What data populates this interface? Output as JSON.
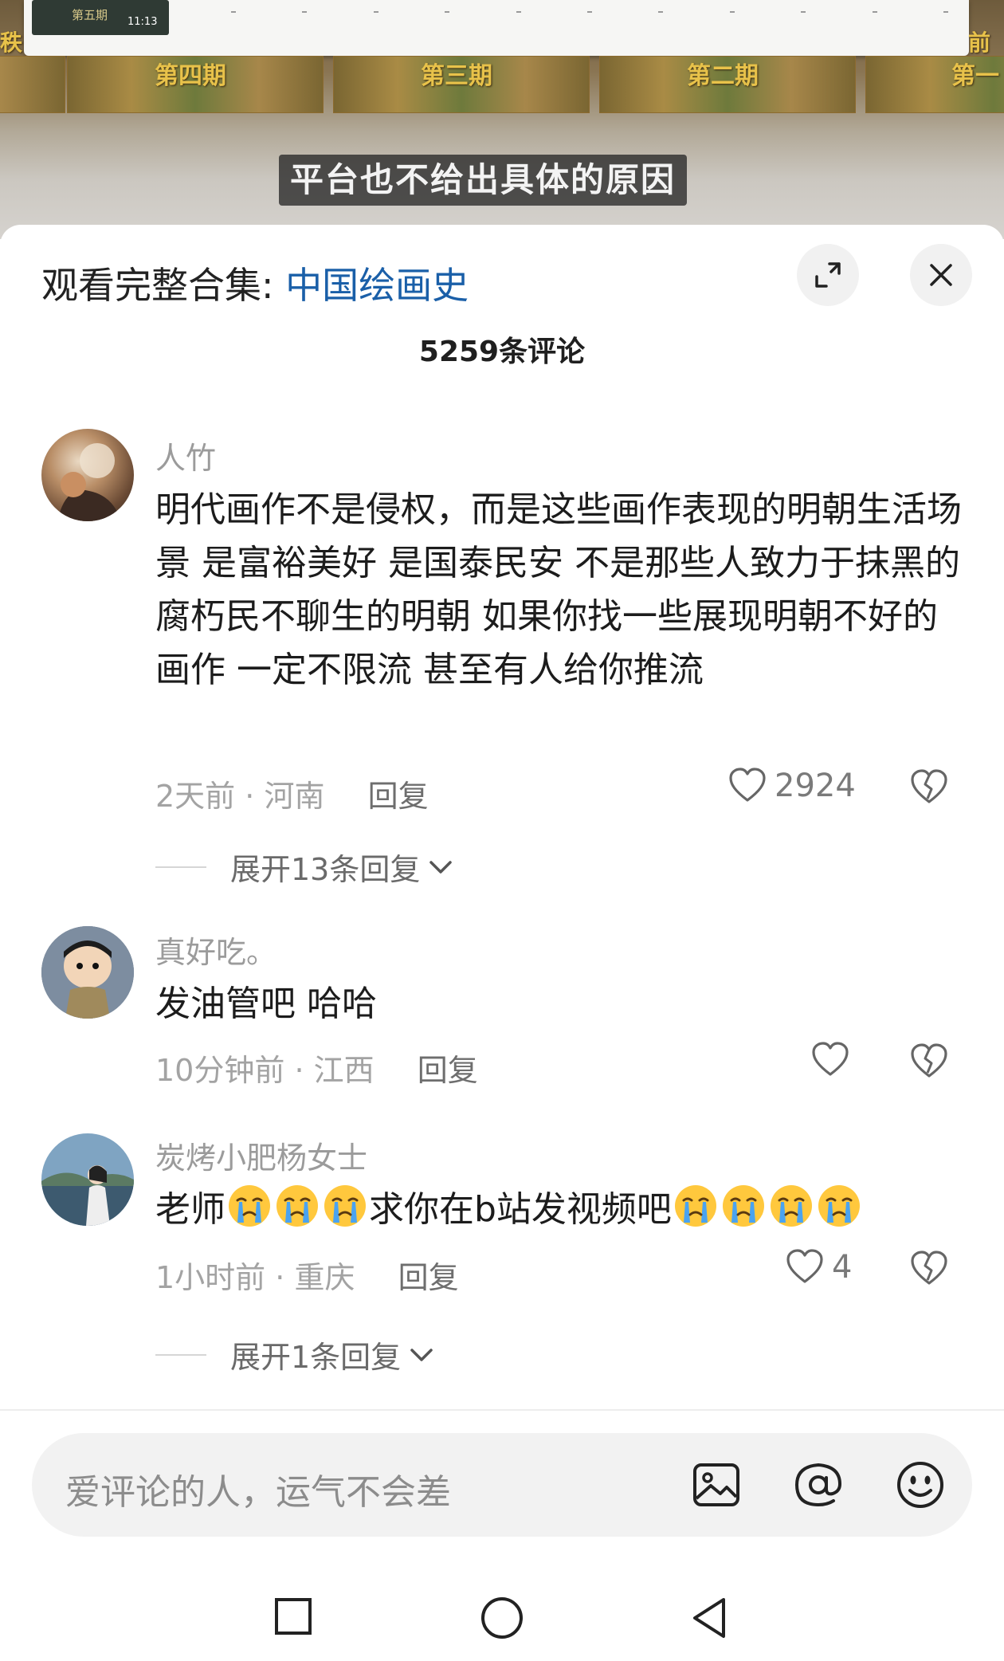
{
  "video": {
    "thumb_caption": "第五期",
    "thumb_time": "11:13",
    "episodes": [
      "第四期",
      "第三期",
      "第二期",
      "第一"
    ],
    "left_edge_text": "秩",
    "right_edge_text": "前至",
    "subtitle": "平台也不给出具体的原因"
  },
  "header": {
    "collection_prefix": "观看完整合集: ",
    "collection_name": "中国绘画史",
    "expand_icon": "expand-icon",
    "close_icon": "close-icon",
    "comment_count": "5259条评论"
  },
  "comments": [
    {
      "username": "人竹",
      "text": "明代画作不是侵权，而是这些画作表现的明朝生活场景 是富裕美好 是国泰民安   不是那些人致力于抹黑的腐朽民不聊生的明朝 如果你找一些展现明朝不好的画作 一定不限流 甚至有人给你推流",
      "time": "2天前",
      "location": "河南",
      "reply_label": "回复",
      "likes": "2924",
      "expand": "展开13条回复"
    },
    {
      "username": "真好吃。",
      "text": "发油管吧 哈哈",
      "time": "10分钟前",
      "location": "江西",
      "reply_label": "回复",
      "likes": ""
    },
    {
      "username": "炭烤小肥杨女士",
      "text_before": "老师",
      "text_middle": "求你在b站发视频吧",
      "emoji_name": "crying-emoji",
      "time": "1小时前",
      "location": "重庆",
      "reply_label": "回复",
      "likes": "4",
      "expand": "展开1条回复"
    }
  ],
  "input": {
    "placeholder": "爱评论的人，运气不会差",
    "icons": [
      "image-icon",
      "at-icon",
      "emoji-icon"
    ]
  },
  "nav": [
    "recent-apps-icon",
    "home-icon",
    "back-icon"
  ],
  "colors": {
    "link": "#1a5fa8",
    "meta": "#a3a3a3",
    "subtitle_bg": "#333333",
    "episode_label": "#e8c24a"
  }
}
